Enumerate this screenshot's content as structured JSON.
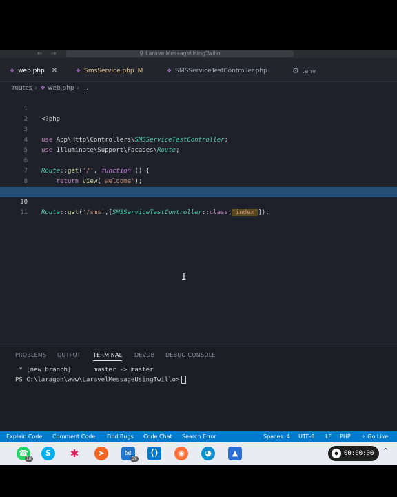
{
  "window": {
    "title": "LaravelMessageUsingTwillo"
  },
  "tabs": [
    {
      "label": "web.php",
      "icon": "php-file-icon",
      "color": "#a074c4",
      "active": true
    },
    {
      "label": "SmsService.php",
      "modified": "M",
      "icon": "php-file-icon",
      "color": "#a074c4"
    },
    {
      "label": "SMSServiceTestController.php",
      "icon": "php-file-icon",
      "color": "#a074c4"
    },
    {
      "label": ".env",
      "icon": "gear-icon",
      "color": "#9da5b4"
    }
  ],
  "breadcrumb": {
    "folder": "routes",
    "file": "web.php",
    "more": "..."
  },
  "editor": {
    "line_numbers": [
      "1",
      "2",
      "3",
      "4",
      "5",
      "6",
      "7",
      "8",
      "9",
      "10",
      "11"
    ],
    "current_line": "10"
  },
  "panel": {
    "tabs": [
      "PROBLEMS",
      "OUTPUT",
      "TERMINAL",
      "DEVDB",
      "DEBUG CONSOLE"
    ],
    "active_tab": "TERMINAL",
    "terminal_lines": [
      " * [new branch]      master -> master",
      "PS C:\\laragon\\www\\LaravelMessageUsingTwillo>"
    ]
  },
  "statusbar": {
    "left": [
      "Explain Code",
      "Comment Code",
      "Find Bugs",
      "Code Chat",
      "Search Error"
    ],
    "right": [
      "Spaces: 4",
      "UTF-8",
      "LF",
      "PHP",
      "Go Live"
    ]
  },
  "taskbar": {
    "badges": {
      "whatsapp": "10",
      "mail": "59"
    },
    "recording_time": "00:00:00"
  },
  "colors": {
    "accent": "#007acc",
    "selection": "#264f78",
    "editor_bg": "#1e2129"
  }
}
